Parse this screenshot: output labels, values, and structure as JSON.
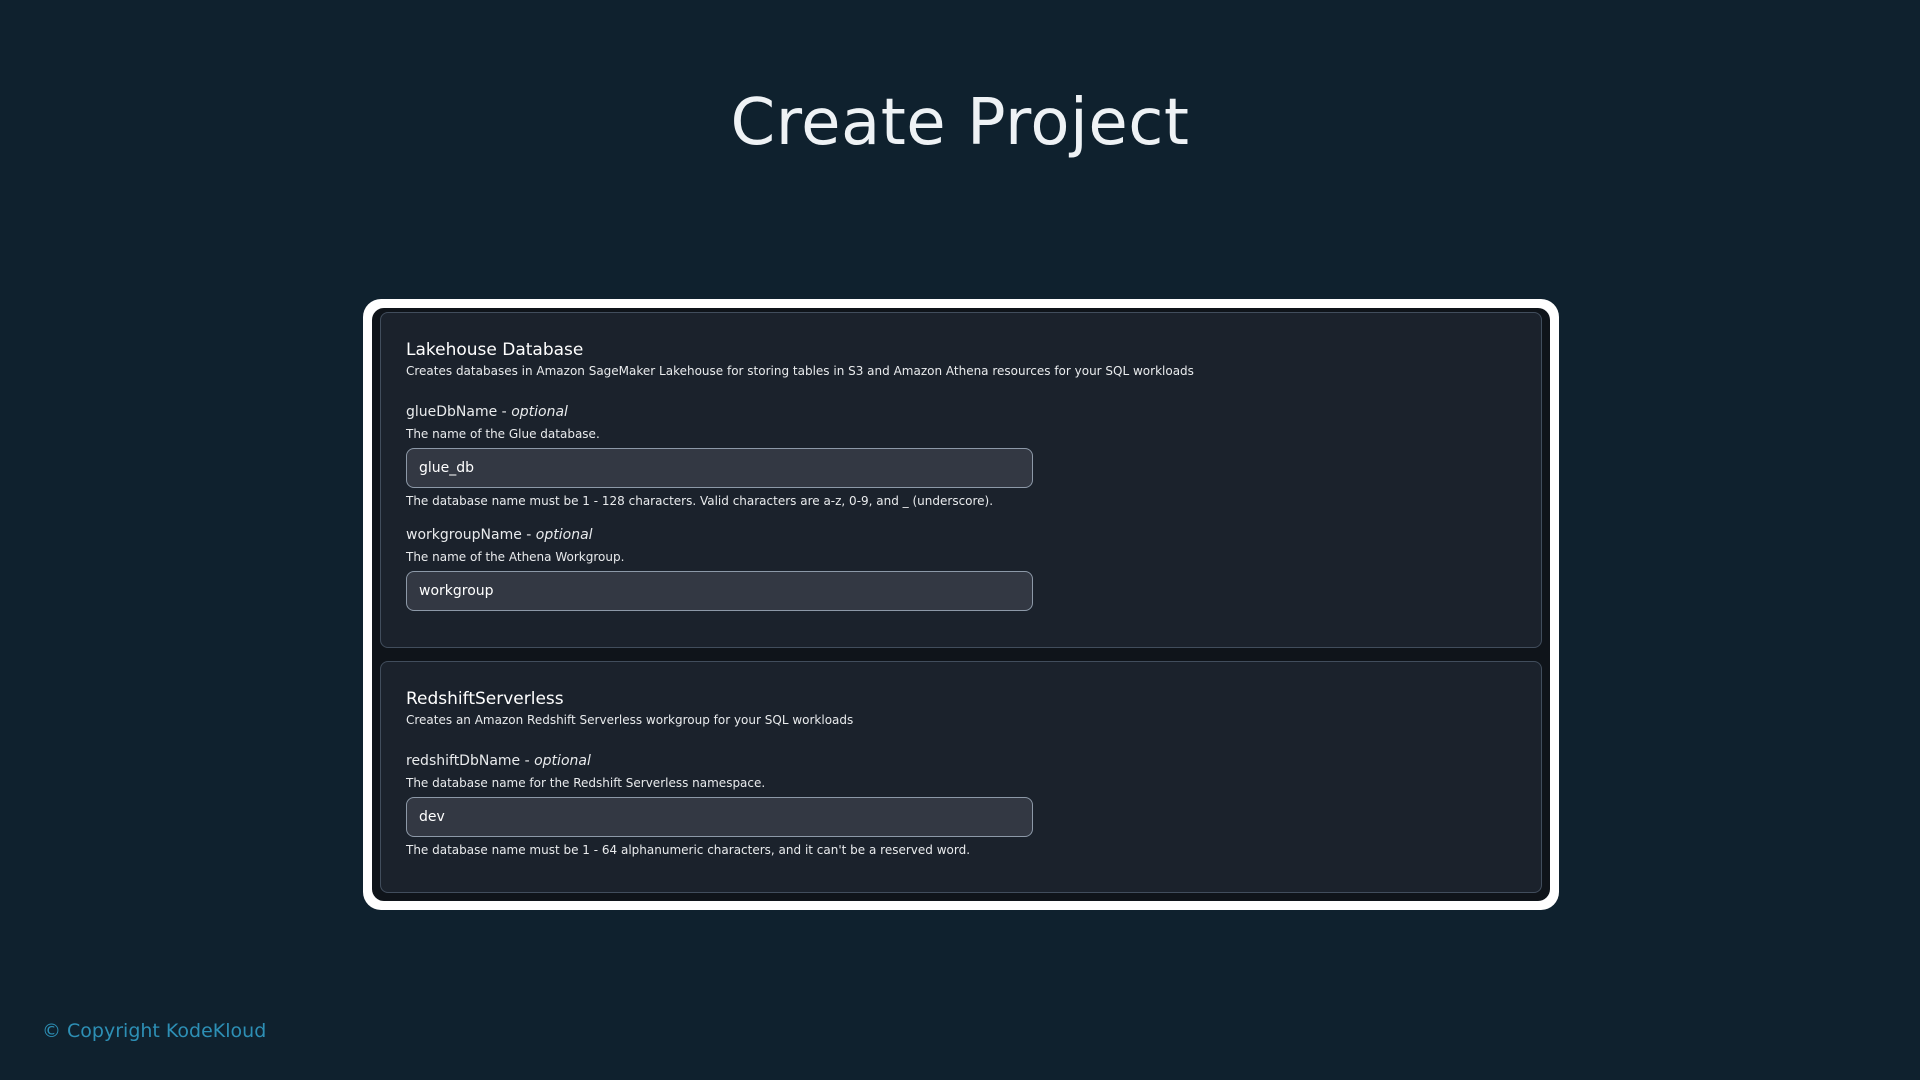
{
  "title": "Create Project",
  "sections": [
    {
      "heading": "Lakehouse Database",
      "description": "Creates databases in Amazon SageMaker Lakehouse for storing tables in S3 and Amazon Athena resources for your SQL workloads",
      "fields": [
        {
          "name": "glueDbName",
          "optional_label": "optional",
          "description": "The name of the Glue database.",
          "value": "glue_db",
          "hint": "The database name must be 1 - 128 characters. Valid characters are a-z, 0-9, and _ (underscore)."
        },
        {
          "name": "workgroupName",
          "optional_label": "optional",
          "description": "The name of the Athena Workgroup.",
          "value": "workgroup"
        }
      ]
    },
    {
      "heading": "RedshiftServerless",
      "description": "Creates an Amazon Redshift Serverless workgroup for your SQL workloads",
      "fields": [
        {
          "name": "redshiftDbName",
          "optional_label": "optional",
          "description": "The database name for the Redshift Serverless namespace.",
          "value": "dev",
          "hint": "The database name must be 1 - 64 alphanumeric characters, and it can't be a reserved word."
        }
      ]
    }
  ],
  "footer": {
    "copyright": "© Copyright KodeKloud"
  },
  "colors": {
    "background": "#0f212e",
    "panel": "#1b222c",
    "input": "#333843",
    "copyright": "#2d8fb5"
  }
}
